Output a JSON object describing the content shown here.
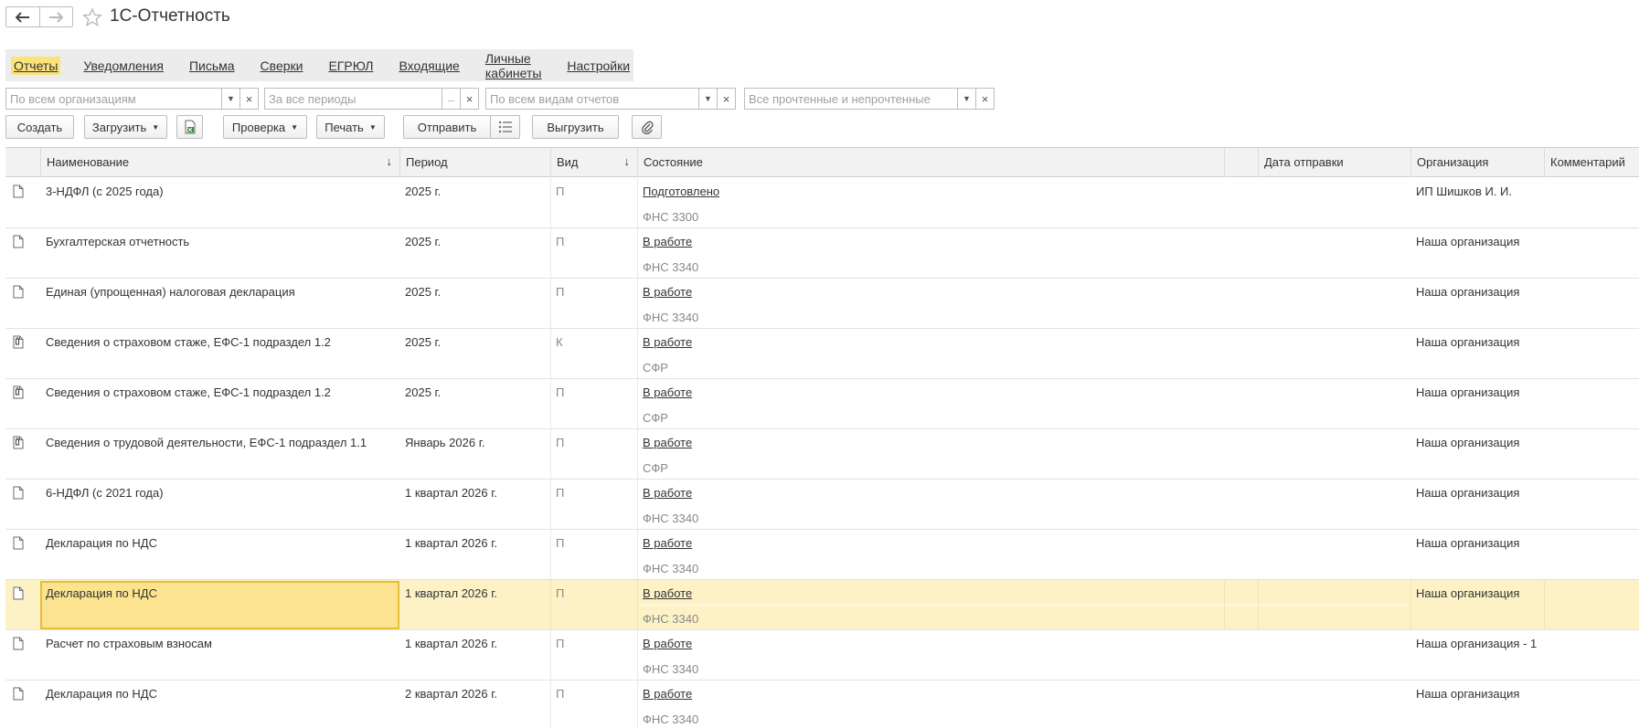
{
  "window": {
    "title": "1С-Отчетность"
  },
  "menu": {
    "items": [
      {
        "label": "Отчеты",
        "active": true
      },
      {
        "label": "Уведомления"
      },
      {
        "label": "Письма"
      },
      {
        "label": "Сверки"
      },
      {
        "label": "ЕГРЮЛ"
      },
      {
        "label": "Входящие"
      },
      {
        "label": "Личные кабинеты"
      },
      {
        "label": "Настройки"
      }
    ]
  },
  "filters": {
    "organization": "По всем организациям",
    "period": "За все периоды",
    "period_btn": "...",
    "report_kind": "По всем видам отчетов",
    "read_state": "Все прочтенные и непрочтенные"
  },
  "toolbar": {
    "create": "Создать",
    "load": "Загрузить",
    "check": "Проверка",
    "print": "Печать",
    "send": "Отправить",
    "upload": "Выгрузить"
  },
  "table": {
    "headers": {
      "name": "Наименование",
      "period": "Период",
      "kind": "Вид",
      "state": "Состояние",
      "sent_date": "Дата отправки",
      "org": "Организация",
      "comment": "Комментарий"
    },
    "rows": [
      {
        "icon": "document-icon",
        "name": "3-НДФЛ (с 2025 года)",
        "period": "2025 г.",
        "kind": "П",
        "state": "Подготовлено",
        "recipient": "ФНС 3300",
        "org": "ИП Шишков И. И."
      },
      {
        "icon": "document-icon",
        "name": "Бухгалтерская отчетность",
        "period": "2025 г.",
        "kind": "П",
        "state": "В работе",
        "recipient": "ФНС 3340",
        "org": "Наша организация"
      },
      {
        "icon": "document-icon",
        "name": "Единая (упрощенная) налоговая декларация",
        "period": "2025 г.",
        "kind": "П",
        "state": "В работе",
        "recipient": "ФНС 3340",
        "org": "Наша организация"
      },
      {
        "icon": "package-document-icon",
        "name": "Сведения о страховом стаже, ЕФС-1 подраздел 1.2",
        "period": "2025 г.",
        "kind": "К",
        "state": "В работе",
        "recipient": "СФР",
        "org": "Наша организация"
      },
      {
        "icon": "package-document-icon",
        "name": "Сведения о страховом стаже, ЕФС-1 подраздел 1.2",
        "period": "2025 г.",
        "kind": "П",
        "state": "В работе",
        "recipient": "СФР",
        "org": "Наша организация"
      },
      {
        "icon": "package-document-icon",
        "name": "Сведения о трудовой деятельности, ЕФС-1 подраздел 1.1",
        "period": "Январь 2026 г.",
        "kind": "П",
        "state": "В работе",
        "recipient": "СФР",
        "org": "Наша организация"
      },
      {
        "icon": "document-icon",
        "name": "6-НДФЛ (с 2021 года)",
        "period": "1 квартал 2026 г.",
        "kind": "П",
        "state": "В работе",
        "recipient": "ФНС 3340",
        "org": "Наша организация"
      },
      {
        "icon": "document-icon",
        "name": "Декларация по НДС",
        "period": "1 квартал 2026 г.",
        "kind": "П",
        "state": "В работе",
        "recipient": "ФНС 3340",
        "org": "Наша организация"
      },
      {
        "icon": "document-icon",
        "name": "Декларация по НДС",
        "period": "1 квартал 2026 г.",
        "kind": "П",
        "state": "В работе",
        "recipient": "ФНС 3340",
        "org": "Наша организация",
        "selected": true
      },
      {
        "icon": "document-icon",
        "name": "Расчет по страховым взносам",
        "period": "1 квартал 2026 г.",
        "kind": "П",
        "state": "В работе",
        "recipient": "ФНС 3340",
        "org": "Наша организация - 1"
      },
      {
        "icon": "document-icon",
        "name": "Декларация по НДС",
        "period": "2 квартал 2026 г.",
        "kind": "П",
        "state": "В работе",
        "recipient": "ФНС 3340",
        "org": "Наша организация"
      }
    ]
  },
  "colors": {
    "accent": "#fbe37b",
    "selected_row": "#fdf2c6",
    "selected_cell": "#fbe390",
    "selected_border": "#e8bd34"
  }
}
